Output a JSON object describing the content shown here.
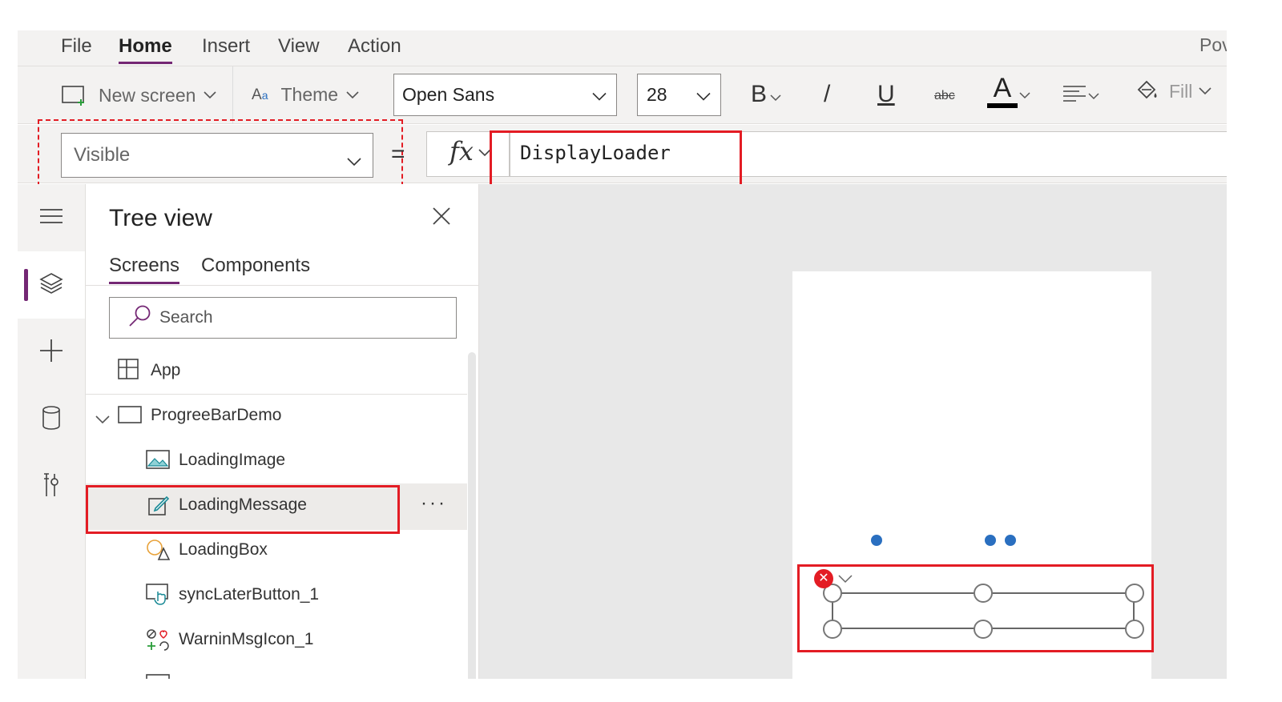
{
  "menu": {
    "items": [
      {
        "label": "File"
      },
      {
        "label": "Home"
      },
      {
        "label": "Insert"
      },
      {
        "label": "View"
      },
      {
        "label": "Action"
      }
    ],
    "active": "Home",
    "brand": "Pov"
  },
  "ribbon": {
    "new_screen": "New screen",
    "theme": "Theme",
    "font": "Open Sans",
    "font_size": "28",
    "fill": "Fill"
  },
  "formula_bar": {
    "property": "Visible",
    "equals": "=",
    "fx": "fx",
    "formula": "DisplayLoader"
  },
  "tree_view": {
    "title": "Tree view",
    "tabs": [
      {
        "label": "Screens"
      },
      {
        "label": "Components"
      }
    ],
    "search_placeholder": "Search",
    "app_label": "App",
    "screen_label": "ProgreeBarDemo",
    "items": [
      {
        "label": "LoadingImage",
        "icon": "image-icon"
      },
      {
        "label": "LoadingMessage",
        "icon": "edit-text-icon"
      },
      {
        "label": "LoadingBox",
        "icon": "shapes-icon"
      },
      {
        "label": "syncLaterButton_1",
        "icon": "button-icon"
      },
      {
        "label": "WarninMsgIcon_1",
        "icon": "icons-icon"
      }
    ],
    "more": "···"
  },
  "colors": {
    "accent": "#742774",
    "highlight": "#e31c24",
    "dots": "#2a6fc0"
  }
}
